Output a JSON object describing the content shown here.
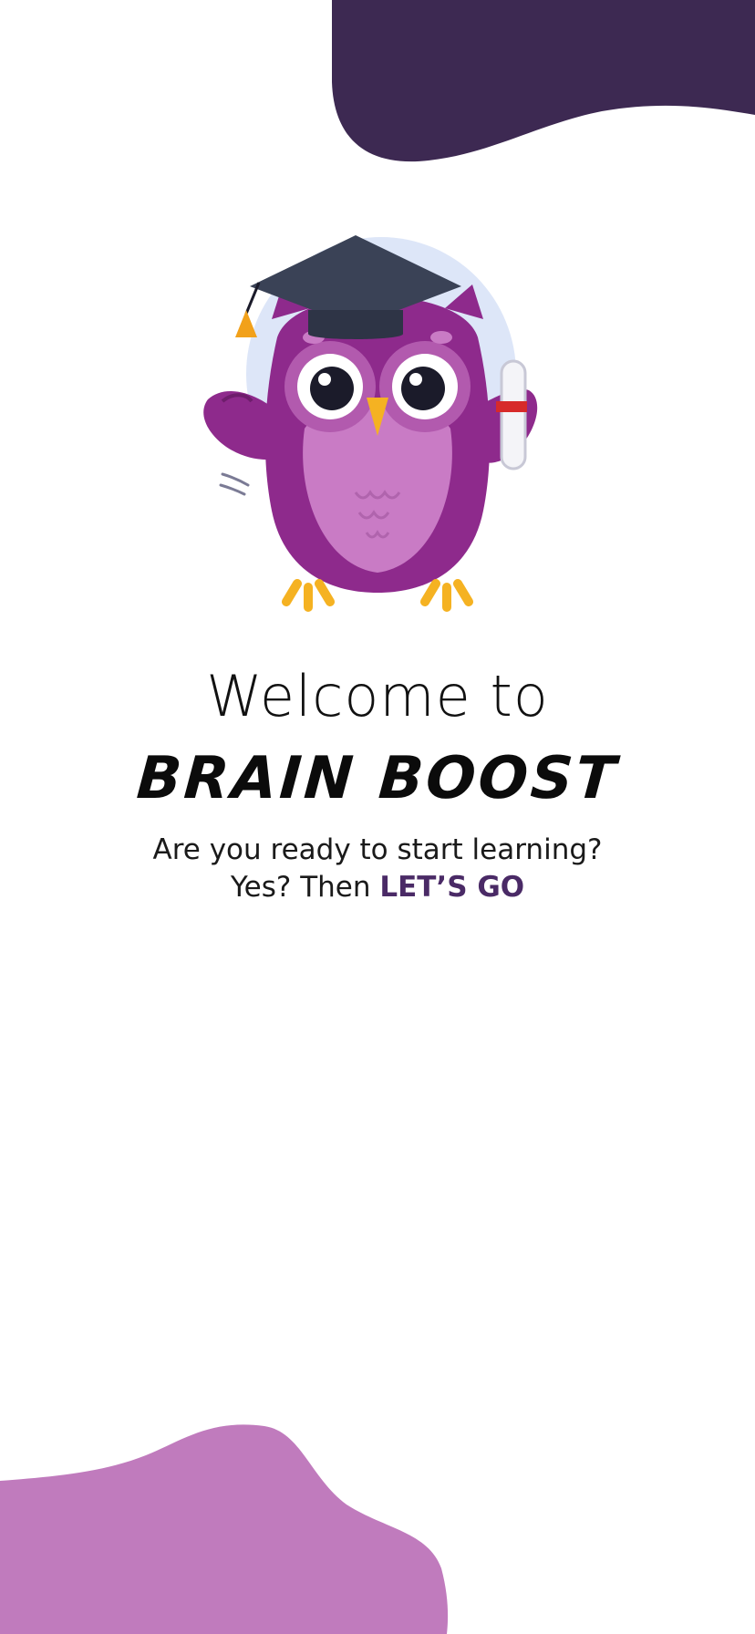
{
  "colors": {
    "top_blob": "#3d2952",
    "bottom_blob": "#c07bbd",
    "owl_body": "#8e2a8c",
    "owl_belly": "#c97bc5",
    "cap": "#3a4256",
    "tassel": "#f2a11a",
    "halo": "#dde6f8",
    "cta_text": "#4a2a66"
  },
  "welcome": {
    "line1": "Welcome to",
    "brand": "BRAIN BOOST"
  },
  "tagline": {
    "question": "Are you ready to start learning?",
    "prefix": "Yes? Then ",
    "cta": "LET’S GO"
  },
  "mascot": {
    "icon": "graduation-owl-icon"
  }
}
